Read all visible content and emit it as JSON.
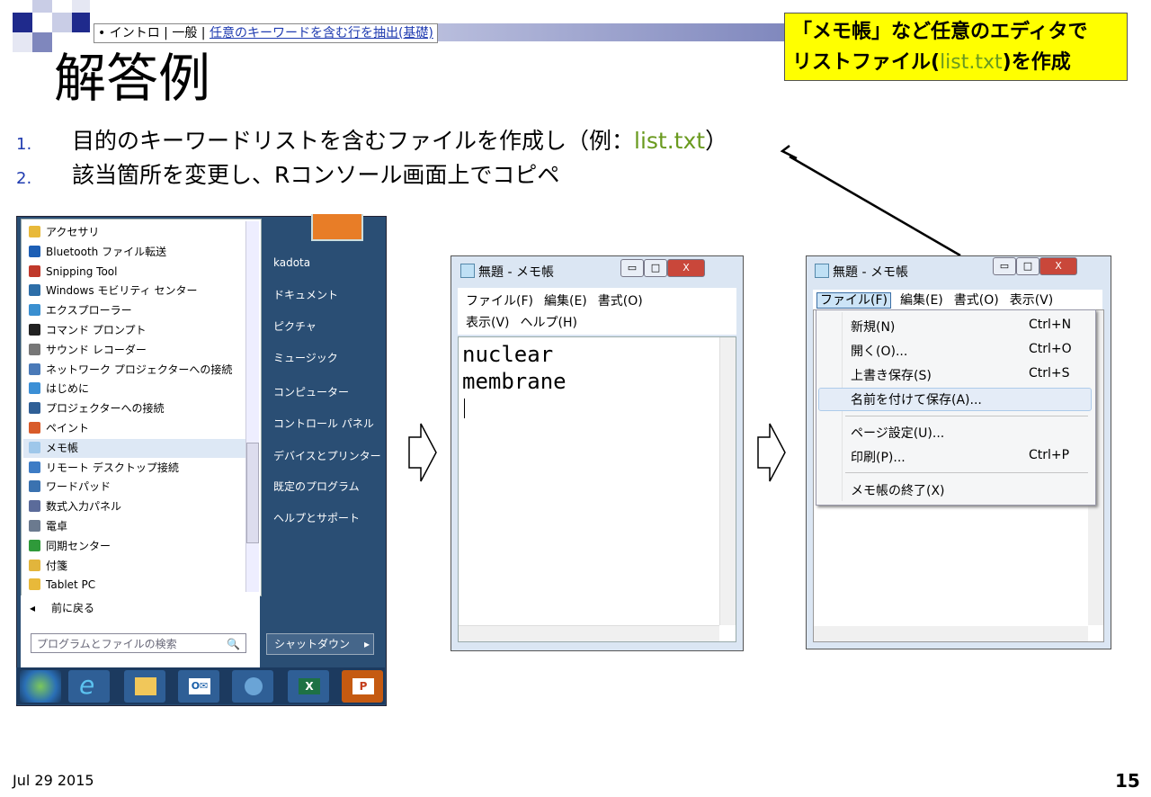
{
  "header": {
    "breadcrumb_prefix": "• イントロ | 一般 | ",
    "breadcrumb_link": "任意のキーワードを含む行を抽出(基礎)",
    "title": "解答例"
  },
  "note": {
    "line1": "「メモ帳」など任意のエディタで",
    "line2_pre": "リストファイル(",
    "line2_file": "list.txt",
    "line2_post": ")を作成"
  },
  "steps": [
    {
      "num": "1.",
      "pre": "目的のキーワードリストを含むファイルを作成し（例：",
      "hl": "list.txt",
      "post": "）"
    },
    {
      "num": "2.",
      "text": "該当箇所を変更し、Rコンソール画面上でコピペ"
    }
  ],
  "start_menu": {
    "items": [
      "アクセサリ",
      "Bluetooth ファイル転送",
      "Snipping Tool",
      "Windows モビリティ センター",
      "エクスプローラー",
      "コマンド プロンプト",
      "サウンド レコーダー",
      "ネットワーク プロジェクターへの接続",
      "はじめに",
      "プロジェクターへの接続",
      "ペイント",
      "メモ帳",
      "リモート デスクトップ接続",
      "ワードパッド",
      "数式入力パネル",
      "電卓",
      "同期センター",
      "付箋",
      "Tablet PC"
    ],
    "back": "前に戻る",
    "search_placeholder": "プログラムとファイルの検索",
    "right_items": [
      "kadota",
      "ドキュメント",
      "ピクチャ",
      "ミュージック",
      "コンピューター",
      "コントロール パネル",
      "デバイスとプリンター",
      "既定のプログラム",
      "ヘルプとサポート"
    ],
    "shutdown": "シャットダウン"
  },
  "notepad1": {
    "title": "無題 - メモ帳",
    "menu_row1": [
      "ファイル(F)",
      "編集(E)",
      "書式(O)"
    ],
    "menu_row2": [
      "表示(V)",
      "ヘルプ(H)"
    ],
    "lines": [
      "nuclear",
      "membrane"
    ]
  },
  "notepad2": {
    "title": "無題 - メモ帳",
    "menu": [
      "ファイル(F)",
      "編集(E)",
      "書式(O)",
      "表示(V)"
    ],
    "file_menu": [
      {
        "label": "新規(N)",
        "shortcut": "Ctrl+N"
      },
      {
        "label": "開く(O)...",
        "shortcut": "Ctrl+O"
      },
      {
        "label": "上書き保存(S)",
        "shortcut": "Ctrl+S"
      },
      {
        "label": "名前を付けて保存(A)...",
        "shortcut": ""
      },
      {
        "label": "ページ設定(U)...",
        "shortcut": ""
      },
      {
        "label": "印刷(P)...",
        "shortcut": "Ctrl+P"
      },
      {
        "label": "メモ帳の終了(X)",
        "shortcut": ""
      }
    ]
  },
  "footer": {
    "date": "Jul 29 2015",
    "page": "15"
  }
}
